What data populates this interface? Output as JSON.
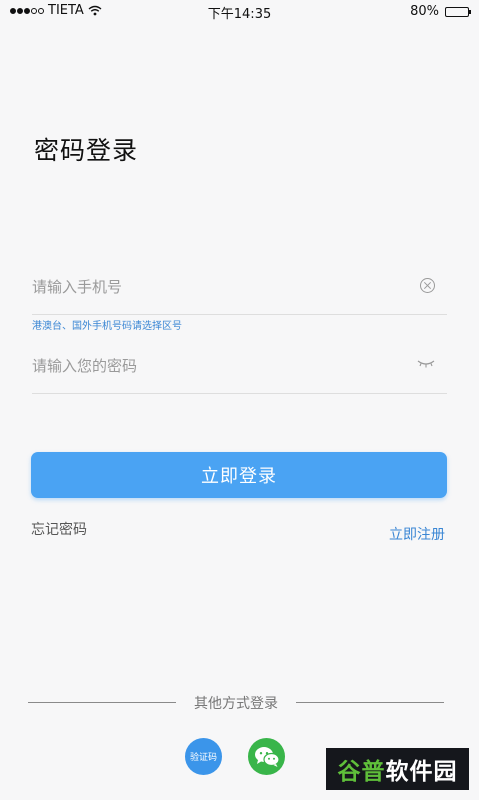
{
  "status_bar": {
    "carrier": "TIETA",
    "time": "下午14:35",
    "battery": "80%",
    "battery_level": 0.8,
    "icons": [
      "signal-dots-icon",
      "wifi-icon",
      "battery-icon"
    ]
  },
  "header": {
    "title": "密码登录"
  },
  "form": {
    "phone": {
      "placeholder": "请输入手机号",
      "value": ""
    },
    "region_hint": "港澳台、国外手机号码请选择区号",
    "password": {
      "placeholder": "请输入您的密码",
      "value": ""
    }
  },
  "actions": {
    "login_label": "立即登录",
    "forgot_label": "忘记密码",
    "register_label": "立即注册"
  },
  "other_login": {
    "label": "其他方式登录",
    "sms_label": "验证码",
    "wechat_icon": "wechat-icon"
  },
  "watermark": {
    "part1": "谷普",
    "part2": "软件园"
  },
  "colors": {
    "accent": "#4aa3f3",
    "link": "#3a86d4",
    "wechat": "#39b54a",
    "background": "#f7f7f8"
  }
}
